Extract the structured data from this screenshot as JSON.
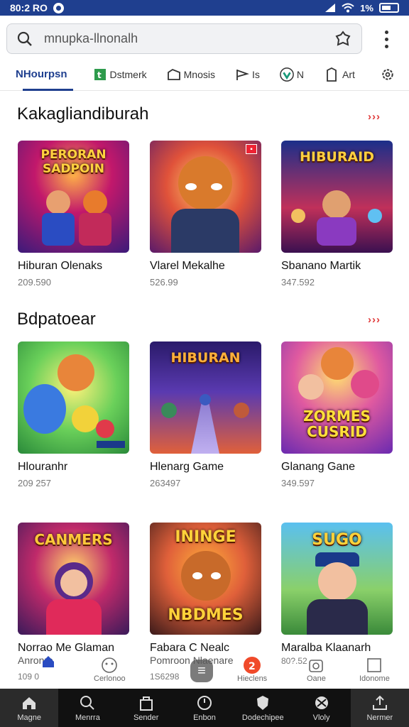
{
  "status_bar": {
    "time": "80:2 RO",
    "battery": "1%"
  },
  "search": {
    "placeholder": "mnupka-llnonalh"
  },
  "tabs": [
    {
      "label": "NHourpsn",
      "icon": "none",
      "active": true
    },
    {
      "label": "Dstmerk",
      "icon": "calendar-icon"
    },
    {
      "label": "Mnosis",
      "icon": "folder-icon"
    },
    {
      "label": "Is",
      "icon": "flag-icon"
    },
    {
      "label": "N",
      "icon": "shield-icon"
    },
    {
      "label": "Art",
      "icon": "document-icon"
    },
    {
      "label": "",
      "icon": "settings-icon"
    }
  ],
  "sections": [
    {
      "title": "Kakagliandiburah",
      "see_more": "›››",
      "cards": [
        {
          "name": "Hiburan Olenaks",
          "count": "209.590",
          "art": "PERORAN SADPOIN"
        },
        {
          "name": "Vlarel Mekalhe",
          "count": "526.99",
          "art": ""
        },
        {
          "name": "Sbanano Martik",
          "count": "347.592",
          "art": "HIBURAID"
        }
      ]
    },
    {
      "title": "Bdpatoear",
      "see_more": "›››",
      "cards": [
        {
          "name": "Hlouranhr",
          "count": "209 257",
          "art": ""
        },
        {
          "name": "Hlenarg Game",
          "count": "263497",
          "art": "HIBURAN"
        },
        {
          "name": "Glanang Gane",
          "count": "349.597",
          "art": "ZORMES CUSRID"
        }
      ]
    },
    {
      "title": "",
      "see_more": "",
      "cards": [
        {
          "name": "Norrao Me Glaman",
          "count": "109 0",
          "subtitle": "Anronre",
          "art": "CANMERS"
        },
        {
          "name": "Fabara C Nealc",
          "count": "1S6298",
          "subtitle": "Pomroon Nlaenare",
          "art": "ININGE NBDMES"
        },
        {
          "name": "Maralba Klaanarh",
          "count": "80?.52",
          "art": "SUGO"
        }
      ]
    }
  ],
  "mini_row": [
    {
      "label": "Cerlonoo",
      "icon": "smile-icon"
    },
    {
      "label": "Hieclens",
      "icon": "fire-icon"
    },
    {
      "label": "Oane",
      "icon": "camera-icon"
    },
    {
      "label": "Idonome",
      "icon": "square-icon"
    }
  ],
  "bottom_nav": [
    {
      "label": "Magne",
      "icon": "home-icon"
    },
    {
      "label": "Menrra",
      "icon": "search-icon"
    },
    {
      "label": "Sender",
      "icon": "bag-icon"
    },
    {
      "label": "Enbon",
      "icon": "clock-icon"
    },
    {
      "label": "Dodechipee",
      "icon": "shield-icon"
    },
    {
      "label": "Vloly",
      "icon": "ball-icon"
    },
    {
      "label": "Nermer",
      "icon": "upload-icon"
    }
  ],
  "colors": {
    "accent": "#1f3f8f",
    "see_more": "#e03a3a",
    "nav_bg": "#111111"
  }
}
